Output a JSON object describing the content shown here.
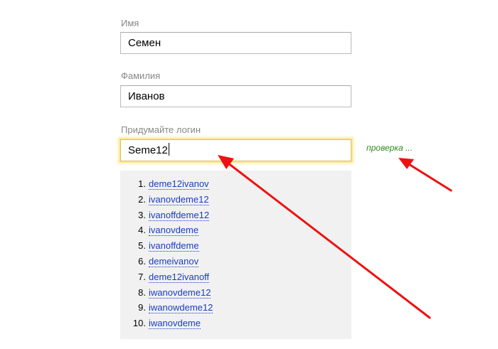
{
  "form": {
    "first_name": {
      "label": "Имя",
      "value": "Семен"
    },
    "last_name": {
      "label": "Фамилия",
      "value": "Иванов"
    },
    "login": {
      "label": "Придумайте логин",
      "value": "Seme12",
      "status": "проверка ..."
    }
  },
  "suggestions": [
    {
      "num": "1.",
      "text": "deme12ivanov"
    },
    {
      "num": "2.",
      "text": "ivanovdeme12"
    },
    {
      "num": "3.",
      "text": "ivanoffdeme12"
    },
    {
      "num": "4.",
      "text": "ivanovdeme"
    },
    {
      "num": "5.",
      "text": "ivanoffdeme"
    },
    {
      "num": "6.",
      "text": "demeivanov"
    },
    {
      "num": "7.",
      "text": "deme12ivanoff"
    },
    {
      "num": "8.",
      "text": "iwanovdeme12"
    },
    {
      "num": "9.",
      "text": "iwanowdeme12"
    },
    {
      "num": "10.",
      "text": "iwanovdeme"
    }
  ],
  "colors": {
    "focus_glow": "#fbe99a",
    "status_text": "#2e8b1e",
    "link": "#1a3dc1",
    "annotation_arrow": "#ee1111",
    "suggest_bg": "#f1f1f1"
  }
}
